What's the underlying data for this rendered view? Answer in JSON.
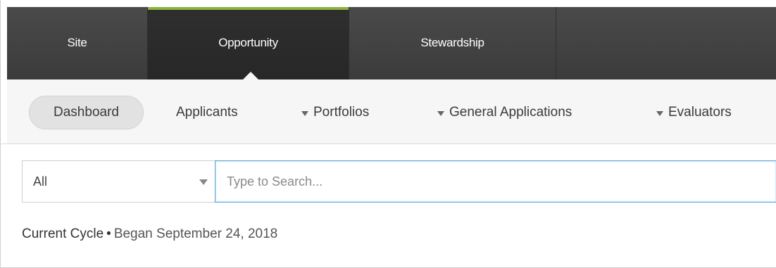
{
  "top_tabs": [
    {
      "label": "Site",
      "active": false
    },
    {
      "label": "Opportunity",
      "active": true
    },
    {
      "label": "Stewardship",
      "active": false
    }
  ],
  "accent_color": "#8cb33e",
  "subnav": {
    "dashboard": "Dashboard",
    "applicants": "Applicants",
    "portfolios": "Portfolios",
    "general_applications": "General Applications",
    "evaluators": "Evaluators"
  },
  "search": {
    "filter_value": "All",
    "placeholder": "Type to Search..."
  },
  "cycle": {
    "label": "Current Cycle",
    "separator": "•",
    "began": "Began September 24, 2018"
  }
}
